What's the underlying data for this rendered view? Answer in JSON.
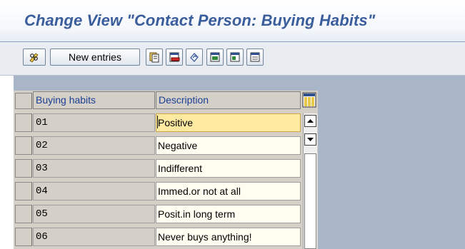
{
  "title": "Change View \"Contact Person: Buying Habits\"",
  "toolbar": {
    "new_entries_label": "New entries",
    "icons": [
      "pen-glasses-icon",
      "copy-as-icon",
      "delete-icon",
      "undo-change-icon",
      "select-all-icon",
      "select-block-icon",
      "deselect-all-icon"
    ]
  },
  "table": {
    "columns": [
      "Buying habits",
      "Description"
    ],
    "rows": [
      {
        "key": "01",
        "description": "Positive"
      },
      {
        "key": "02",
        "description": "Negative"
      },
      {
        "key": "03",
        "description": "Indifferent"
      },
      {
        "key": "04",
        "description": "Immed.or not at all"
      },
      {
        "key": "05",
        "description": "Posit.in long term"
      },
      {
        "key": "06",
        "description": "Never buys anything!"
      }
    ]
  },
  "colors": {
    "title": "#3a5d9c",
    "header_text": "#1c3f94",
    "active_cell": "#fde9a0",
    "work_area": "#a8b6c7"
  }
}
